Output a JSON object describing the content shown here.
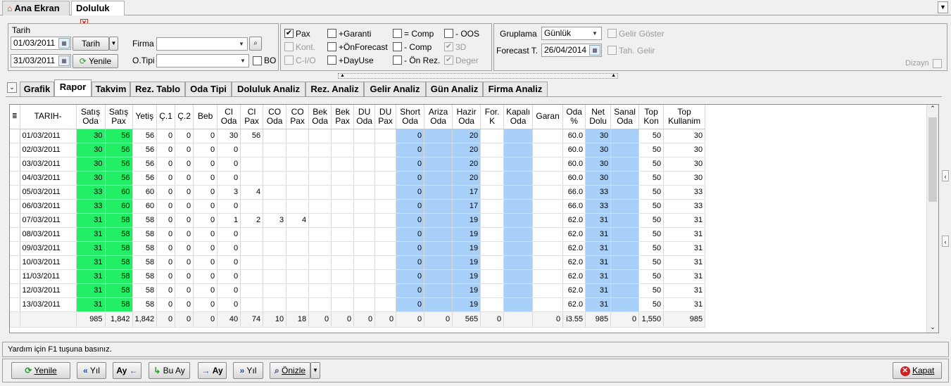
{
  "tabs": {
    "home": "Ana Ekran",
    "active": "Doluluk"
  },
  "filters": {
    "tarih_label": "Tarih",
    "date_from": "01/03/2011",
    "date_to": "31/03/2011",
    "tarih_button": "Tarih",
    "yenile_button": "Yenile",
    "firma_label": "Firma",
    "firma_value": "",
    "otipi_label": "O.Tipi",
    "otipi_value": "",
    "bo_label": "BO"
  },
  "checks": {
    "pax": "Pax",
    "kont": "Kont.",
    "cio": "C-I/O",
    "garanti": "+Garanti",
    "onforecast": "+ÖnForecast",
    "dayuse": "+DayUse",
    "comp_eq": "= Comp",
    "comp_minus": "- Comp",
    "onrez": "- Ön Rez.",
    "oos": "- OOS",
    "three_d": "3D",
    "deger": "Deger"
  },
  "grouping": {
    "gruplama_label": "Gruplama",
    "gruplama_value": "Günlük",
    "forecast_label": "Forecast T.",
    "forecast_value": "26/04/2014",
    "gelir_goster": "Gelir Göster",
    "tah_gelir": "Tah. Gelir",
    "dizayn": "Dizayn"
  },
  "view_tabs": [
    "Grafik",
    "Rapor",
    "Takvim",
    "Rez. Tablo",
    "Oda Tipi",
    "Doluluk Analiz",
    "Rez. Analiz",
    "Gelir Analiz",
    "Gün Analiz",
    "Firma Analiz"
  ],
  "table": {
    "headers": [
      "TARIH-",
      "Satış Oda",
      "Satış Pax",
      "Yetiş",
      "Ç.1",
      "Ç.2",
      "Beb",
      "CI Oda",
      "CI Pax",
      "CO Oda",
      "CO Pax",
      "Bek Oda",
      "Bek Pax",
      "DU Oda",
      "DU Pax",
      "Short Oda",
      "Ariza Oda",
      "Hazir Oda",
      "For. K",
      "Kapalı Oda",
      "Garan",
      "Oda %",
      "Net Dolu",
      "Sanal Oda",
      "Top Kon",
      "Top Kullanim"
    ],
    "rows": [
      [
        "01/03/2011",
        "30",
        "56",
        "56",
        "0",
        "0",
        "0",
        "30",
        "56",
        "",
        "",
        "",
        "",
        "",
        "",
        "0",
        "",
        "20",
        "",
        "",
        "",
        "60.0",
        "30",
        "",
        "50",
        "30"
      ],
      [
        "02/03/2011",
        "30",
        "56",
        "56",
        "0",
        "0",
        "0",
        "0",
        "",
        "",
        "",
        "",
        "",
        "",
        "",
        "0",
        "",
        "20",
        "",
        "",
        "",
        "60.0",
        "30",
        "",
        "50",
        "30"
      ],
      [
        "03/03/2011",
        "30",
        "56",
        "56",
        "0",
        "0",
        "0",
        "0",
        "",
        "",
        "",
        "",
        "",
        "",
        "",
        "0",
        "",
        "20",
        "",
        "",
        "",
        "60.0",
        "30",
        "",
        "50",
        "30"
      ],
      [
        "04/03/2011",
        "30",
        "56",
        "56",
        "0",
        "0",
        "0",
        "0",
        "",
        "",
        "",
        "",
        "",
        "",
        "",
        "0",
        "",
        "20",
        "",
        "",
        "",
        "60.0",
        "30",
        "",
        "50",
        "30"
      ],
      [
        "05/03/2011",
        "33",
        "60",
        "60",
        "0",
        "0",
        "0",
        "3",
        "4",
        "",
        "",
        "",
        "",
        "",
        "",
        "0",
        "",
        "17",
        "",
        "",
        "",
        "66.0",
        "33",
        "",
        "50",
        "33"
      ],
      [
        "06/03/2011",
        "33",
        "60",
        "60",
        "0",
        "0",
        "0",
        "0",
        "",
        "",
        "",
        "",
        "",
        "",
        "",
        "0",
        "",
        "17",
        "",
        "",
        "",
        "66.0",
        "33",
        "",
        "50",
        "33"
      ],
      [
        "07/03/2011",
        "31",
        "58",
        "58",
        "0",
        "0",
        "0",
        "1",
        "2",
        "3",
        "4",
        "",
        "",
        "",
        "",
        "0",
        "",
        "19",
        "",
        "",
        "",
        "62.0",
        "31",
        "",
        "50",
        "31"
      ],
      [
        "08/03/2011",
        "31",
        "58",
        "58",
        "0",
        "0",
        "0",
        "0",
        "",
        "",
        "",
        "",
        "",
        "",
        "",
        "0",
        "",
        "19",
        "",
        "",
        "",
        "62.0",
        "31",
        "",
        "50",
        "31"
      ],
      [
        "09/03/2011",
        "31",
        "58",
        "58",
        "0",
        "0",
        "0",
        "0",
        "",
        "",
        "",
        "",
        "",
        "",
        "",
        "0",
        "",
        "19",
        "",
        "",
        "",
        "62.0",
        "31",
        "",
        "50",
        "31"
      ],
      [
        "10/03/2011",
        "31",
        "58",
        "58",
        "0",
        "0",
        "0",
        "0",
        "",
        "",
        "",
        "",
        "",
        "",
        "",
        "0",
        "",
        "19",
        "",
        "",
        "",
        "62.0",
        "31",
        "",
        "50",
        "31"
      ],
      [
        "11/03/2011",
        "31",
        "58",
        "58",
        "0",
        "0",
        "0",
        "0",
        "",
        "",
        "",
        "",
        "",
        "",
        "",
        "0",
        "",
        "19",
        "",
        "",
        "",
        "62.0",
        "31",
        "",
        "50",
        "31"
      ],
      [
        "12/03/2011",
        "31",
        "58",
        "58",
        "0",
        "0",
        "0",
        "0",
        "",
        "",
        "",
        "",
        "",
        "",
        "",
        "0",
        "",
        "19",
        "",
        "",
        "",
        "62.0",
        "31",
        "",
        "50",
        "31"
      ],
      [
        "13/03/2011",
        "31",
        "58",
        "58",
        "0",
        "0",
        "0",
        "0",
        "",
        "",
        "",
        "",
        "",
        "",
        "",
        "0",
        "",
        "19",
        "",
        "",
        "",
        "62.0",
        "31",
        "",
        "50",
        "31"
      ]
    ],
    "footer": [
      "",
      "985",
      "1,842",
      "1,842",
      "0",
      "0",
      "0",
      "40",
      "74",
      "10",
      "18",
      "0",
      "0",
      "0",
      "0",
      "0",
      "0",
      "565",
      "0",
      "",
      "0",
      "i3.55",
      "985",
      "0",
      "1,550",
      "985"
    ]
  },
  "status": "Yardım için F1 tuşuna basınız.",
  "buttons": {
    "yenile": "Yenile",
    "yil_prev": "Yıl",
    "ay_prev": "Ay",
    "bu_ay": "Bu Ay",
    "ay_next": "Ay",
    "yil_next": "Yıl",
    "onizle": "Önizle",
    "kapat": "Kapat"
  },
  "colors": {
    "green": "#22ee66",
    "blue": "#a8d0f8"
  }
}
